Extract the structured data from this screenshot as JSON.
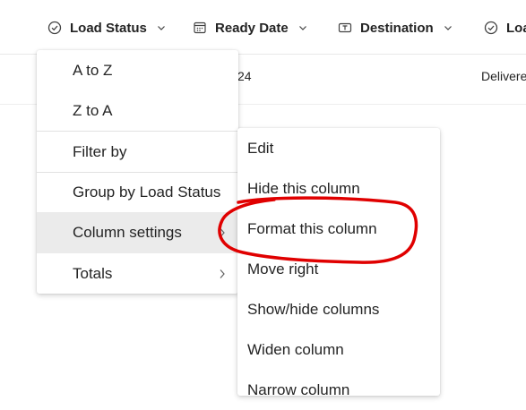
{
  "header": {
    "columns": [
      {
        "label": "Load Status",
        "icon": "status-check-icon"
      },
      {
        "label": "Ready Date",
        "icon": "calendar-icon"
      },
      {
        "label": "Destination",
        "icon": "text-field-icon"
      },
      {
        "label": "Loa",
        "icon": "status-check-icon"
      }
    ]
  },
  "row": {
    "date_fragment": "24",
    "status_fragment": "Delivere"
  },
  "column_menu": {
    "items": [
      {
        "label": "A to Z"
      },
      {
        "label": "Z to A"
      },
      {
        "label": "Filter by"
      },
      {
        "label": "Group by Load Status"
      },
      {
        "label": "Column settings",
        "has_submenu": true,
        "active": true
      },
      {
        "label": "Totals",
        "has_submenu": true
      }
    ]
  },
  "settings_submenu": {
    "items": [
      {
        "label": "Edit"
      },
      {
        "label": "Hide this column"
      },
      {
        "label": "Format this column",
        "highlighted": true
      },
      {
        "label": "Move right"
      },
      {
        "label": "Show/hide columns"
      },
      {
        "label": "Widen column"
      },
      {
        "label": "Narrow column"
      }
    ]
  },
  "colors": {
    "annotation_red": "#e00000",
    "active_item_bg": "#ebebeb",
    "text": "#242424"
  }
}
